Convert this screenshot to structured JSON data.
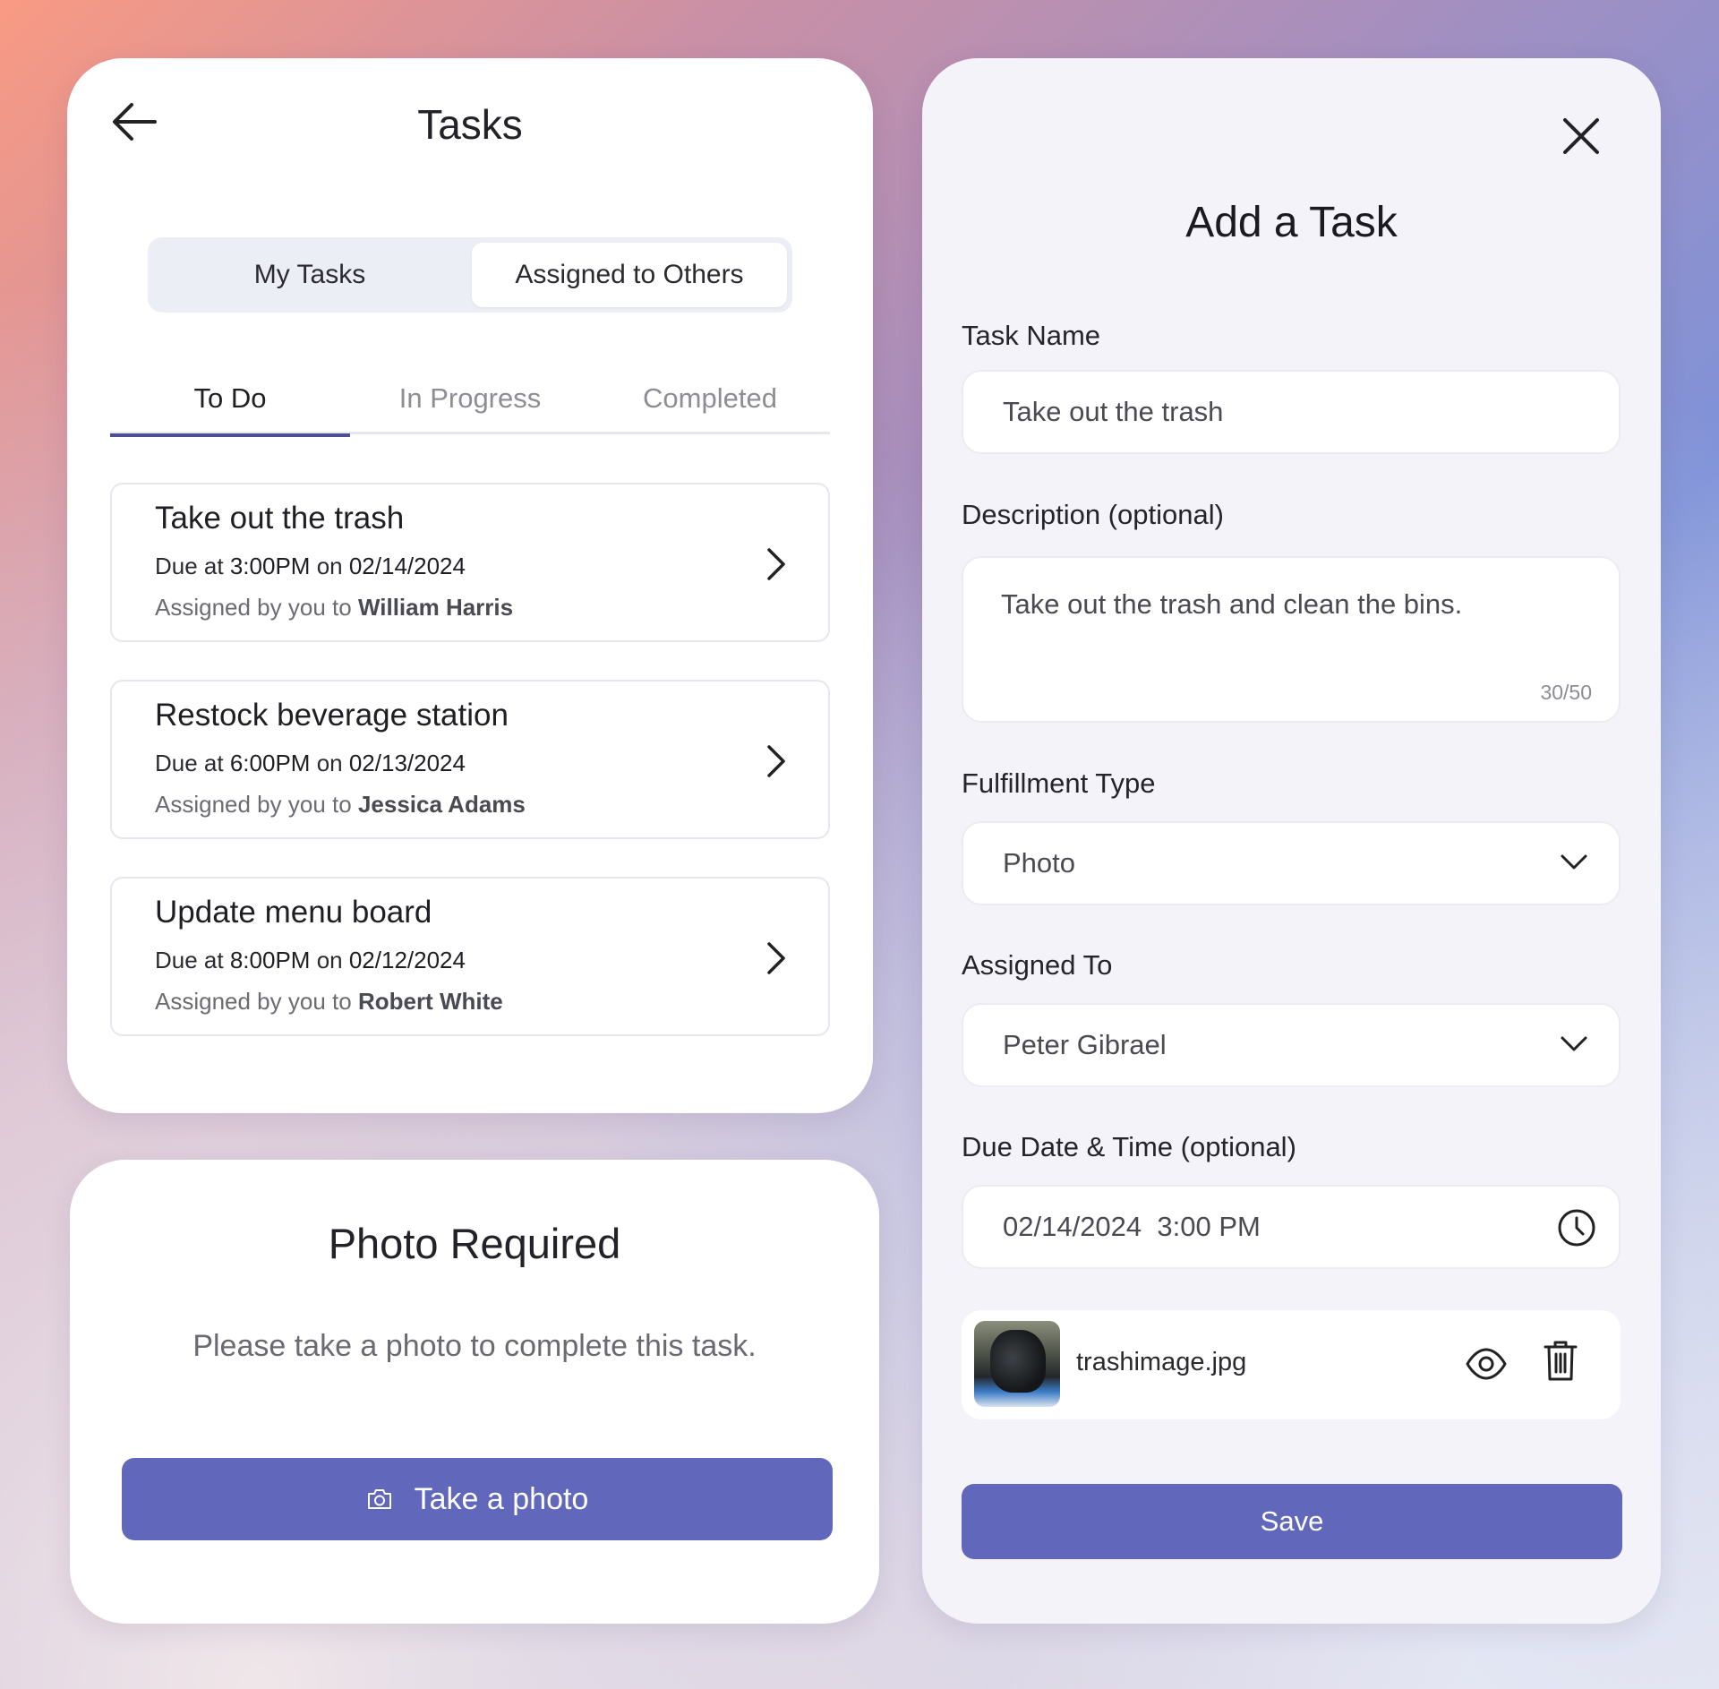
{
  "tasks_screen": {
    "title": "Tasks",
    "segments": {
      "my_tasks": "My Tasks",
      "assigned_to_others": "Assigned to Others",
      "selected": "Assigned to Others"
    },
    "status_tabs": [
      {
        "label": "To Do",
        "active": true
      },
      {
        "label": "In Progress",
        "active": false
      },
      {
        "label": "Completed",
        "active": false
      }
    ],
    "items": [
      {
        "title": "Take out the trash",
        "due_prefix": "Due at",
        "time": "3:00PM",
        "on": "on",
        "date": "02/14/2024",
        "assign_prefix": "Assigned by you to",
        "assignee": "William Harris"
      },
      {
        "title": "Restock beverage station",
        "due_prefix": "Due at",
        "time": "6:00PM",
        "on": "on",
        "date": "02/13/2024",
        "assign_prefix": "Assigned by you to",
        "assignee": "Jessica Adams"
      },
      {
        "title": "Update menu board",
        "due_prefix": "Due at",
        "time": "8:00PM",
        "on": "on",
        "date": "02/12/2024",
        "assign_prefix": "Assigned by you to",
        "assignee": "Robert White"
      }
    ]
  },
  "photo_required": {
    "title": "Photo Required",
    "description": "Please take a photo to complete this task.",
    "button_label": "Take a photo"
  },
  "add_task": {
    "title": "Add a Task",
    "task_name_label": "Task Name",
    "task_name_value": "Take out the trash",
    "description_label": "Description (optional)",
    "description_value": "Take out the trash and clean the bins.",
    "description_counter": "30/50",
    "fulfillment_label": "Fulfillment Type",
    "fulfillment_value": "Photo",
    "assigned_label": "Assigned To",
    "assigned_value": "Peter Gibrael",
    "due_label": "Due Date & Time (optional)",
    "due_date": "02/14/2024",
    "due_time": "3:00 PM",
    "attachment_name": "trashimage.jpg",
    "save_label": "Save"
  },
  "colors": {
    "primary": "#6167ba",
    "tab_indicator": "#4c4f96",
    "card_bg": "#ffffff",
    "form_bg": "#f4f3f9"
  },
  "icons": [
    "back-arrow-icon",
    "chevron-right-icon",
    "camera-icon",
    "close-icon",
    "chevron-down-icon",
    "clock-icon",
    "eye-icon",
    "trash-icon"
  ]
}
